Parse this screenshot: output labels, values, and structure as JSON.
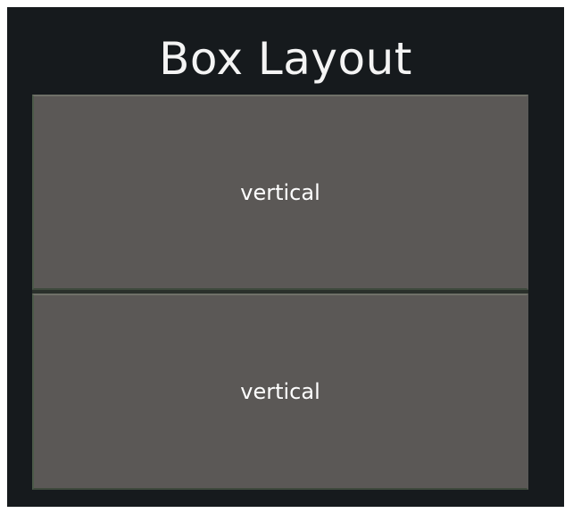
{
  "window": {
    "title": "Box Layout"
  },
  "buttons": [
    {
      "label": "vertical"
    },
    {
      "label": "vertical"
    }
  ],
  "colors": {
    "background": "#161a1d",
    "button": "#5b5856",
    "text": "#ffffff"
  }
}
